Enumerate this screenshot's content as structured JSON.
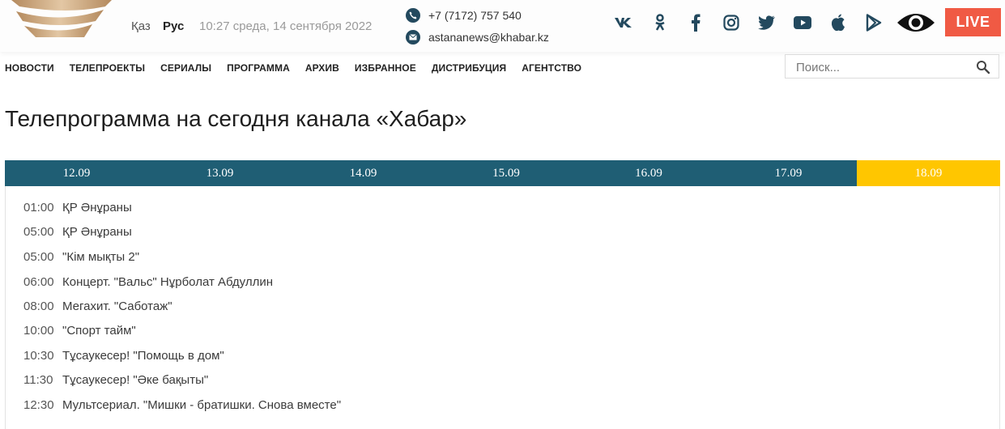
{
  "header": {
    "languages": {
      "kz": "Қаз",
      "ru": "Рус"
    },
    "datetime": "10:27 среда, 14 сентября 2022",
    "phone": "+7 (7172) 757 540",
    "email": "astananews@khabar.kz",
    "social_icons": [
      "vk-icon",
      "odnoklassniki-icon",
      "facebook-icon",
      "instagram-icon",
      "twitter-icon",
      "youtube-icon",
      "apple-icon",
      "google-play-icon"
    ],
    "live_label": "LIVE",
    "colors": {
      "brand_dark": "#23495e",
      "live": "#f05a44",
      "logo_gold": "#c9a57a"
    }
  },
  "nav": {
    "items": [
      "Новости",
      "Телепроекты",
      "Сериалы",
      "Программа",
      "Архив",
      "Избранное",
      "Дистрибуция",
      "Агентство"
    ]
  },
  "search": {
    "placeholder": "Поиск..."
  },
  "page": {
    "title": "Телепрограмма на сегодня канала «Хабар»"
  },
  "tabs": {
    "items": [
      "12.09",
      "13.09",
      "14.09",
      "15.09",
      "16.09",
      "17.09",
      "18.09"
    ],
    "active": "18.09",
    "colors": {
      "bar": "#1f5e74",
      "active": "#ffc600"
    }
  },
  "schedule": [
    {
      "time": "01:00",
      "title": "ҚР Әнұраны"
    },
    {
      "time": "05:00",
      "title": "ҚР Әнұраны"
    },
    {
      "time": "05:00",
      "title": "\"Кім мықты 2\""
    },
    {
      "time": "06:00",
      "title": "Концерт. \"Вальс\" Нұрболат Абдуллин"
    },
    {
      "time": "08:00",
      "title": "Мегахит. \"Саботаж\""
    },
    {
      "time": "10:00",
      "title": "\"Спорт тайм\""
    },
    {
      "time": "10:30",
      "title": "Тұсаукесер! \"Помощь в дом\""
    },
    {
      "time": "11:30",
      "title": "Тұсаукесер! \"Әке бақыты\""
    },
    {
      "time": "12:30",
      "title": "Мультсериал. \"Мишки - братишки. Снова вместе\""
    }
  ]
}
